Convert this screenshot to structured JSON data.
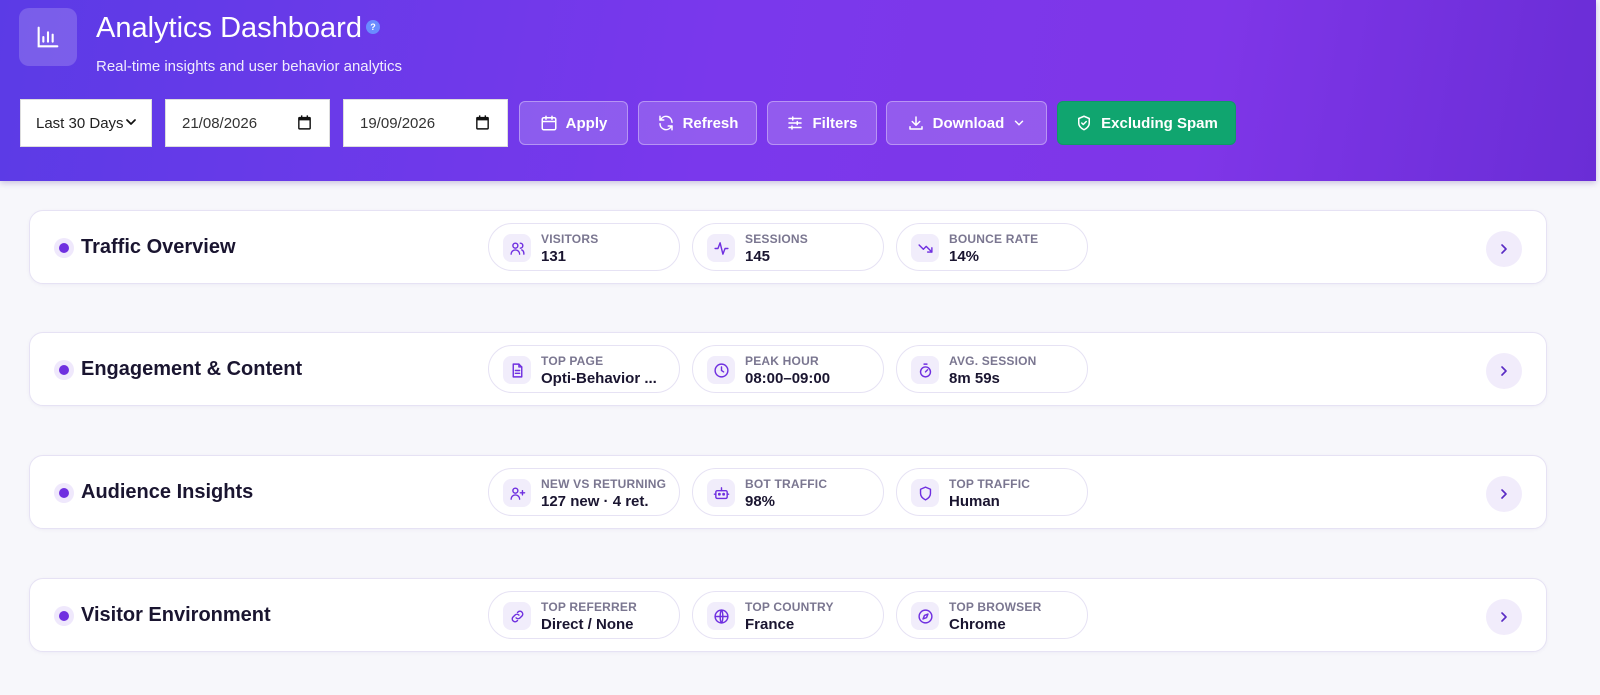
{
  "header": {
    "title": "Analytics Dashboard",
    "help": "?",
    "subtitle": "Real-time insights and user behavior analytics",
    "range_select": "Last 30 Days",
    "date_from": "21/08/2026",
    "date_to": "19/09/2026",
    "buttons": {
      "apply": "Apply",
      "refresh": "Refresh",
      "filters": "Filters",
      "download": "Download",
      "spam": "Excluding Spam"
    }
  },
  "cards": [
    {
      "title": "Traffic Overview",
      "stats": [
        {
          "label": "VISITORS",
          "value": "131",
          "icon": "users-icon"
        },
        {
          "label": "SESSIONS",
          "value": "145",
          "icon": "activity-icon"
        },
        {
          "label": "BOUNCE RATE",
          "value": "14%",
          "icon": "trending-down-icon"
        }
      ]
    },
    {
      "title": "Engagement & Content",
      "stats": [
        {
          "label": "TOP PAGE",
          "value": "Opti-Behavior ...",
          "icon": "document-icon"
        },
        {
          "label": "PEAK HOUR",
          "value": "08:00–09:00",
          "icon": "clock-icon"
        },
        {
          "label": "AVG. SESSION",
          "value": "8m 59s",
          "icon": "timer-icon"
        }
      ]
    },
    {
      "title": "Audience Insights",
      "stats": [
        {
          "label": "NEW VS RETURNING",
          "value": "127 new · 4 ret.",
          "icon": "user-plus-icon"
        },
        {
          "label": "BOT TRAFFIC",
          "value": "98%",
          "icon": "bot-icon"
        },
        {
          "label": "TOP TRAFFIC",
          "value": "Human",
          "icon": "shield-icon"
        }
      ]
    },
    {
      "title": "Visitor Environment",
      "stats": [
        {
          "label": "TOP REFERRER",
          "value": "Direct / None",
          "icon": "link-icon"
        },
        {
          "label": "TOP COUNTRY",
          "value": "France",
          "icon": "globe-icon"
        },
        {
          "label": "TOP BROWSER",
          "value": "Chrome",
          "icon": "compass-icon"
        }
      ]
    }
  ],
  "colors": {
    "accent": "#6f2fe0",
    "header_start": "#5b3be6",
    "header_end": "#7f36e8",
    "spam_button": "#10a56f"
  }
}
